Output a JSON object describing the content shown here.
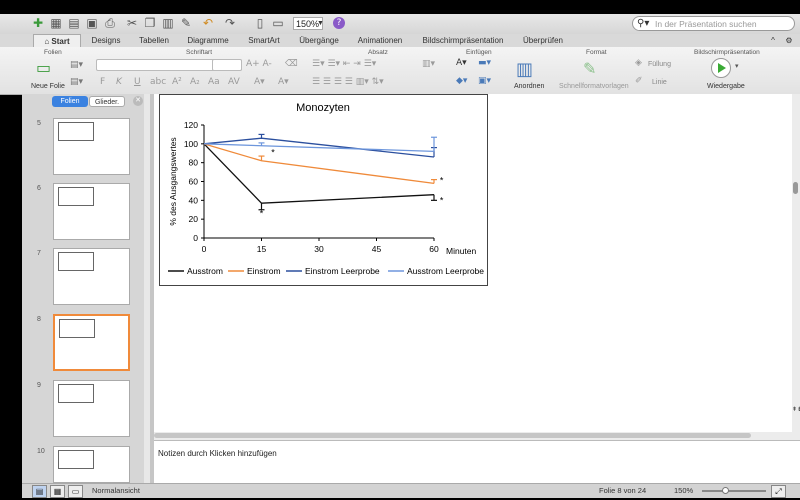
{
  "toolbar": {
    "zoom": "150%",
    "search_placeholder": "In der Präsentation suchen"
  },
  "tabs": [
    "Start",
    "Designs",
    "Tabellen",
    "Diagramme",
    "SmartArt",
    "Übergänge",
    "Animationen",
    "Bildschirmpräsentation",
    "Überprüfen"
  ],
  "ribbon": {
    "groups": [
      "Folien",
      "Schriftart",
      "Absatz",
      "Einfügen",
      "Format",
      "Bildschirmpräsentation"
    ],
    "new_slide": "Neue Folie",
    "arrange": "Anordnen",
    "quick_styles": "Schnellformatvorlagen",
    "fill": "Füllung",
    "line": "Linie",
    "playback": "Wiedergabe"
  },
  "panel": {
    "tab_slides": "Folien",
    "tab_outline": "Glieder.",
    "slide_numbers": [
      "5",
      "6",
      "7",
      "8",
      "9",
      "10"
    ],
    "selected_slide": "8"
  },
  "notes": {
    "placeholder": "Notizen durch Klicken hinzufügen"
  },
  "status": {
    "view": "Normalansicht",
    "slide_position": "Folie 8 von 24",
    "zoom": "150%"
  },
  "colors": {
    "accent_orange": "#f08a3a",
    "series_black": "#111111",
    "series_orange": "#ef8a3a",
    "series_darkblue": "#2b4f9e",
    "series_lightblue": "#6d96dc",
    "play_green": "#3aaa35"
  },
  "chart_data": {
    "type": "line",
    "title": "Monozyten",
    "ylabel": "% des Ausgangswertes",
    "xlabel": "Minuten",
    "x": [
      0,
      15,
      60
    ],
    "xticks": [
      "0",
      "15",
      "30",
      "45",
      "60"
    ],
    "yticks": [
      "0",
      "20",
      "40",
      "60",
      "80",
      "100",
      "120"
    ],
    "xlim": [
      0,
      60
    ],
    "ylim": [
      0,
      120
    ],
    "grid": false,
    "legend": "bottom",
    "series": [
      {
        "name": "Ausstrom",
        "values": [
          100,
          37,
          46
        ],
        "errors": [
          0,
          7,
          6
        ],
        "color": "#111111"
      },
      {
        "name": "Einstrom",
        "values": [
          100,
          82,
          58
        ],
        "errors": [
          0,
          5,
          4
        ],
        "color": "#ef8a3a"
      },
      {
        "name": "Einstrom Leerprobe",
        "values": [
          100,
          106,
          86
        ],
        "errors": [
          0,
          4,
          10
        ],
        "color": "#2b4f9e"
      },
      {
        "name": "Ausstrom Leerprobe",
        "values": [
          100,
          98,
          92
        ],
        "errors": [
          0,
          3,
          15
        ],
        "color": "#6d96dc"
      }
    ],
    "annotations": [
      {
        "text": "*",
        "x": 15,
        "y": 26
      },
      {
        "text": "*",
        "x": 18,
        "y": 91
      },
      {
        "text": "*",
        "x": 62,
        "y": 61
      },
      {
        "text": "*",
        "x": 62,
        "y": 40
      }
    ]
  }
}
